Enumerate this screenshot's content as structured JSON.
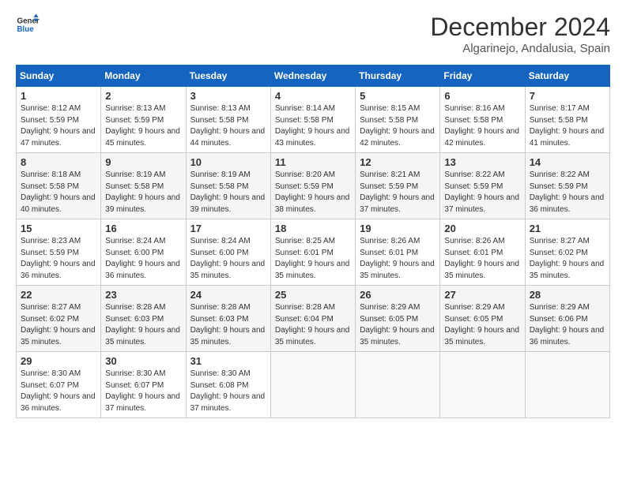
{
  "header": {
    "logo_general": "General",
    "logo_blue": "Blue",
    "month_title": "December 2024",
    "subtitle": "Algarinejo, Andalusia, Spain"
  },
  "weekdays": [
    "Sunday",
    "Monday",
    "Tuesday",
    "Wednesday",
    "Thursday",
    "Friday",
    "Saturday"
  ],
  "weeks": [
    [
      {
        "day": "1",
        "sunrise": "8:12 AM",
        "sunset": "5:59 PM",
        "daylight": "9 hours and 47 minutes."
      },
      {
        "day": "2",
        "sunrise": "8:13 AM",
        "sunset": "5:59 PM",
        "daylight": "9 hours and 45 minutes."
      },
      {
        "day": "3",
        "sunrise": "8:13 AM",
        "sunset": "5:58 PM",
        "daylight": "9 hours and 44 minutes."
      },
      {
        "day": "4",
        "sunrise": "8:14 AM",
        "sunset": "5:58 PM",
        "daylight": "9 hours and 43 minutes."
      },
      {
        "day": "5",
        "sunrise": "8:15 AM",
        "sunset": "5:58 PM",
        "daylight": "9 hours and 42 minutes."
      },
      {
        "day": "6",
        "sunrise": "8:16 AM",
        "sunset": "5:58 PM",
        "daylight": "9 hours and 42 minutes."
      },
      {
        "day": "7",
        "sunrise": "8:17 AM",
        "sunset": "5:58 PM",
        "daylight": "9 hours and 41 minutes."
      }
    ],
    [
      {
        "day": "8",
        "sunrise": "8:18 AM",
        "sunset": "5:58 PM",
        "daylight": "9 hours and 40 minutes."
      },
      {
        "day": "9",
        "sunrise": "8:19 AM",
        "sunset": "5:58 PM",
        "daylight": "9 hours and 39 minutes."
      },
      {
        "day": "10",
        "sunrise": "8:19 AM",
        "sunset": "5:58 PM",
        "daylight": "9 hours and 39 minutes."
      },
      {
        "day": "11",
        "sunrise": "8:20 AM",
        "sunset": "5:59 PM",
        "daylight": "9 hours and 38 minutes."
      },
      {
        "day": "12",
        "sunrise": "8:21 AM",
        "sunset": "5:59 PM",
        "daylight": "9 hours and 37 minutes."
      },
      {
        "day": "13",
        "sunrise": "8:22 AM",
        "sunset": "5:59 PM",
        "daylight": "9 hours and 37 minutes."
      },
      {
        "day": "14",
        "sunrise": "8:22 AM",
        "sunset": "5:59 PM",
        "daylight": "9 hours and 36 minutes."
      }
    ],
    [
      {
        "day": "15",
        "sunrise": "8:23 AM",
        "sunset": "5:59 PM",
        "daylight": "9 hours and 36 minutes."
      },
      {
        "day": "16",
        "sunrise": "8:24 AM",
        "sunset": "6:00 PM",
        "daylight": "9 hours and 36 minutes."
      },
      {
        "day": "17",
        "sunrise": "8:24 AM",
        "sunset": "6:00 PM",
        "daylight": "9 hours and 35 minutes."
      },
      {
        "day": "18",
        "sunrise": "8:25 AM",
        "sunset": "6:01 PM",
        "daylight": "9 hours and 35 minutes."
      },
      {
        "day": "19",
        "sunrise": "8:26 AM",
        "sunset": "6:01 PM",
        "daylight": "9 hours and 35 minutes."
      },
      {
        "day": "20",
        "sunrise": "8:26 AM",
        "sunset": "6:01 PM",
        "daylight": "9 hours and 35 minutes."
      },
      {
        "day": "21",
        "sunrise": "8:27 AM",
        "sunset": "6:02 PM",
        "daylight": "9 hours and 35 minutes."
      }
    ],
    [
      {
        "day": "22",
        "sunrise": "8:27 AM",
        "sunset": "6:02 PM",
        "daylight": "9 hours and 35 minutes."
      },
      {
        "day": "23",
        "sunrise": "8:28 AM",
        "sunset": "6:03 PM",
        "daylight": "9 hours and 35 minutes."
      },
      {
        "day": "24",
        "sunrise": "8:28 AM",
        "sunset": "6:03 PM",
        "daylight": "9 hours and 35 minutes."
      },
      {
        "day": "25",
        "sunrise": "8:28 AM",
        "sunset": "6:04 PM",
        "daylight": "9 hours and 35 minutes."
      },
      {
        "day": "26",
        "sunrise": "8:29 AM",
        "sunset": "6:05 PM",
        "daylight": "9 hours and 35 minutes."
      },
      {
        "day": "27",
        "sunrise": "8:29 AM",
        "sunset": "6:05 PM",
        "daylight": "9 hours and 35 minutes."
      },
      {
        "day": "28",
        "sunrise": "8:29 AM",
        "sunset": "6:06 PM",
        "daylight": "9 hours and 36 minutes."
      }
    ],
    [
      {
        "day": "29",
        "sunrise": "8:30 AM",
        "sunset": "6:07 PM",
        "daylight": "9 hours and 36 minutes."
      },
      {
        "day": "30",
        "sunrise": "8:30 AM",
        "sunset": "6:07 PM",
        "daylight": "9 hours and 37 minutes."
      },
      {
        "day": "31",
        "sunrise": "8:30 AM",
        "sunset": "6:08 PM",
        "daylight": "9 hours and 37 minutes."
      },
      null,
      null,
      null,
      null
    ]
  ]
}
